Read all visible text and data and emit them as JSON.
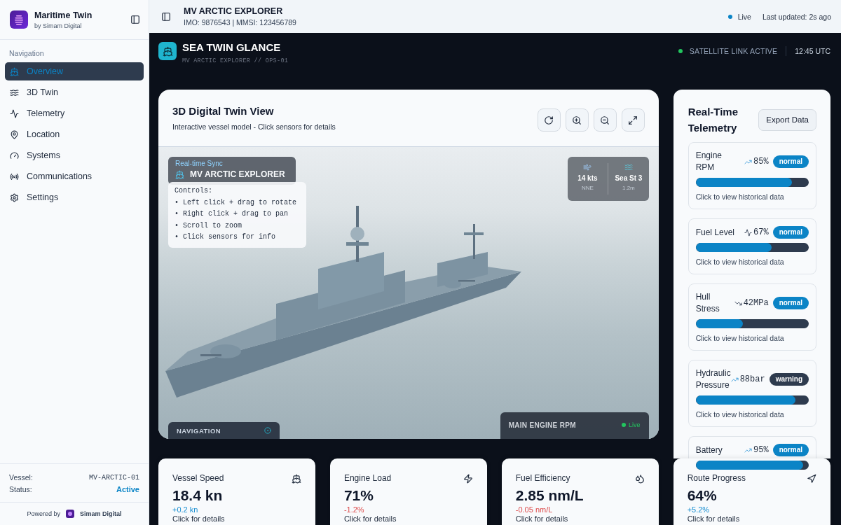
{
  "sidebar": {
    "brand": {
      "name": "Maritime Twin",
      "byline": "by Simam Digital"
    },
    "section_label": "Navigation",
    "items": [
      {
        "label": "Overview",
        "selected": true
      },
      {
        "label": "3D Twin",
        "selected": false
      },
      {
        "label": "Telemetry",
        "selected": false
      },
      {
        "label": "Location",
        "selected": false
      },
      {
        "label": "Systems",
        "selected": false
      },
      {
        "label": "Communications",
        "selected": false
      },
      {
        "label": "Settings",
        "selected": false
      }
    ],
    "vessel_info": [
      {
        "label": "Vessel:",
        "value": "MV-ARCTIC-01",
        "kind": "code"
      },
      {
        "label": "Status:",
        "value": "Active",
        "kind": "status"
      }
    ],
    "footer": {
      "prefix": "Powered by",
      "company": "Simam Digital"
    }
  },
  "header": {
    "vessel_name": "MV ARCTIC EXPLORER",
    "identifiers": "IMO: 9876543 | MMSI: 123456789",
    "live": {
      "label": "Live",
      "on": true
    },
    "last_updated": "Last updated: 2s ago"
  },
  "banner": {
    "title": "SEA TWIN GLANCE",
    "subtitle": "MV ARCTIC EXPLORER // OPS-01",
    "link_status": "SATELLITE LINK ACTIVE",
    "link_active": true,
    "time": "12:45 UTC"
  },
  "twin_view": {
    "title": "3D Digital Twin View",
    "subtitle": "Interactive vessel model - Click sensors for details",
    "viewport": {
      "sync_label": "Real-time Sync",
      "vessel_name": "MV ARCTIC EXPLORER",
      "controls": {
        "title": "Controls:",
        "items": [
          "• Left click + drag to rotate",
          "• Right click + drag to pan",
          "• Scroll to zoom",
          "• Click sensors for info"
        ]
      },
      "conditions": [
        {
          "value": "14 kts",
          "detail": "NNE"
        },
        {
          "value": "Sea St 3",
          "detail": "1.2m"
        }
      ],
      "navigation_panel": {
        "title": "NAVIGATION"
      },
      "engine_panel": {
        "title": "MAIN ENGINE RPM",
        "status": "Live",
        "live": true
      }
    }
  },
  "telemetry": {
    "title": "Real-Time Telemetry",
    "export_button": "Export Data",
    "items": [
      {
        "label": "Engine RPM",
        "kind": "rising",
        "value": "85%",
        "badge": "normal",
        "warning": false,
        "level": 0.85,
        "hint": "Click to view historical data"
      },
      {
        "label": "Fuel Level",
        "kind": "steady",
        "value": "67%",
        "badge": "normal",
        "warning": false,
        "level": 0.67,
        "hint": "Click to view historical data"
      },
      {
        "label": "Hull Stress",
        "kind": "falling",
        "value": "42MPa",
        "badge": "normal",
        "warning": false,
        "level": 0.42,
        "hint": "Click to view historical data"
      },
      {
        "label": "Hydraulic Pressure",
        "kind": "rising",
        "value": "88bar",
        "badge": "warning",
        "warning": true,
        "level": 0.88,
        "hint": "Click to view historical data"
      },
      {
        "label": "Battery",
        "kind": "rising",
        "value": "95%",
        "badge": "normal",
        "warning": false,
        "level": 0.95
      }
    ]
  },
  "stats": [
    {
      "label": "Vessel Speed",
      "value": "18.4 kn",
      "change": "+0.2 kn",
      "kind": "gain",
      "hint": "Click for details"
    },
    {
      "label": "Engine Load",
      "value": "71%",
      "change": "-1.2%",
      "kind": "loss",
      "hint": "Click for details"
    },
    {
      "label": "Fuel Efficiency",
      "value": "2.85 nm/L",
      "change": "-0.05 nm/L",
      "kind": "loss",
      "hint": "Click for details"
    },
    {
      "label": "Route Progress",
      "value": "64%",
      "change": "+5.2%",
      "kind": "gain",
      "hint": "Click for details"
    }
  ]
}
